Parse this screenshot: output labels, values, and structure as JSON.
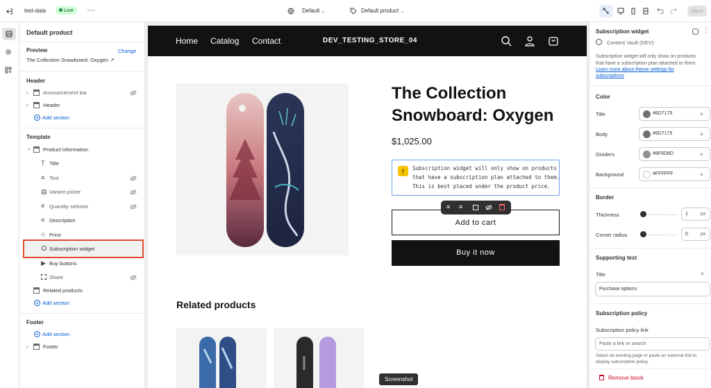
{
  "topbar": {
    "store": "test-data",
    "live": "Live",
    "theme": "Default",
    "template": "Default product",
    "save": "Save"
  },
  "left": {
    "title": "Default product",
    "preview_label": "Preview",
    "change": "Change",
    "preview_value": "The Collection Snowboard: Oxygen",
    "header_section": "Header",
    "announcement": "Announcement bar",
    "header": "Header",
    "add_section": "Add section",
    "template_section": "Template",
    "product_info": "Product information",
    "blocks": [
      "Title",
      "Text",
      "Variant picker",
      "Quantity selector",
      "Description",
      "Price",
      "Subscription widget",
      "Buy buttons",
      "Share"
    ],
    "related": "Related products",
    "footer_section": "Footer",
    "footer": "Footer"
  },
  "store": {
    "nav": [
      "Home",
      "Catalog",
      "Contact"
    ],
    "name": "DEV_TESTING_STORE_04",
    "title_line1": "The Collection",
    "title_line2": "Snowboard: Oxygen",
    "price": "$1,025.00",
    "notice": [
      "Subscription widget will only show on products",
      "that have a subscription plan attached to them.",
      "This is best placed under the product price."
    ],
    "add_to_cart": "Add to cart",
    "buy_now": "Buy it now",
    "related": "Related products",
    "tooltip": "Screenshot"
  },
  "right": {
    "title": "Subscription widget",
    "app": "Content Vault (DEV)",
    "desc1": "Subscription widget will only show on products",
    "desc2": "that have a subscription plan attached to them.",
    "link1": "Learn more about theme settings for",
    "link2": "subscriptions",
    "color_h": "Color",
    "colors": [
      {
        "label": "Title",
        "value": "#6D7175",
        "hex": "#6D7175"
      },
      {
        "label": "Body",
        "value": "#6D7175",
        "hex": "#6D7175"
      },
      {
        "label": "Dividers",
        "value": "#8F8D8D",
        "hex": "#8F8D8D"
      },
      {
        "label": "Background",
        "value": "#FFFFFF",
        "hex": "#FFFFFF"
      }
    ],
    "border_h": "Border",
    "thickness": "Thickness",
    "thickness_val": "1",
    "corner": "Corner radius",
    "corner_val": "0",
    "px": "px",
    "support_h": "Supporting text",
    "support_title": "Title",
    "support_value": "Purchase options",
    "policy_h": "Subscription policy",
    "policy_link": "Subscription policy link",
    "policy_ph": "Paste a link or search",
    "policy_help1": "Select an existing page or paste an external link to",
    "policy_help2": "display subscription policy.",
    "remove": "Remove block"
  },
  "colors": {
    "accent": "#005bd3",
    "highlight": "#e04b2b",
    "store_header": "#121212",
    "live_bg": "#cdfed4",
    "live_fg": "#0c5132"
  }
}
